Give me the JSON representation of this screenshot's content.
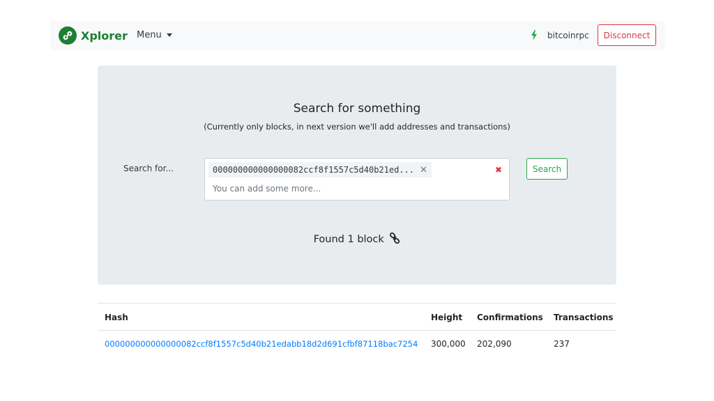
{
  "navbar": {
    "brand": "Xplorer",
    "menu_label": "Menu",
    "connection_name": "bitcoinrpc",
    "disconnect_label": "Disconnect"
  },
  "search": {
    "title": "Search for something",
    "subtitle": "(Currently only blocks, in next version we'll add addresses and transactions)",
    "label": "Search for...",
    "tag_value": "000000000000000082ccf8f1557c5d40b21ed...",
    "placeholder": "You can add some more...",
    "button_label": "Search",
    "result_text": "Found 1 block"
  },
  "table": {
    "headers": [
      "Hash",
      "Height",
      "Confirmations",
      "Transactions"
    ],
    "rows": [
      {
        "hash": "000000000000000082ccf8f1557c5d40b21edabb18d2d691cfbf87118bac7254",
        "height": "300,000",
        "confirmations": "202,090",
        "transactions": "237"
      }
    ]
  },
  "colors": {
    "brand": "#1e7e34",
    "danger": "#dc3545",
    "success": "#28a745",
    "link": "#007bff",
    "panel": "#e9ecef"
  }
}
